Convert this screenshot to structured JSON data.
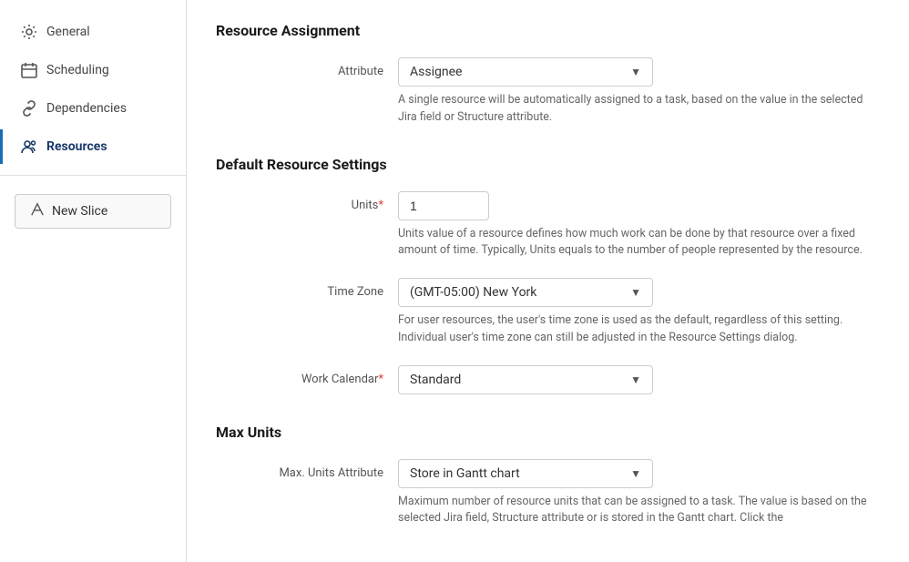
{
  "sidebar": {
    "items": [
      {
        "id": "general",
        "label": "General",
        "icon": "settings-icon",
        "active": false
      },
      {
        "id": "scheduling",
        "label": "Scheduling",
        "icon": "calendar-icon",
        "active": false
      },
      {
        "id": "dependencies",
        "label": "Dependencies",
        "icon": "link-icon",
        "active": false
      },
      {
        "id": "resources",
        "label": "Resources",
        "icon": "people-icon",
        "active": true
      }
    ],
    "new_slice_label": "New Slice"
  },
  "main": {
    "sections": [
      {
        "id": "resource-assignment",
        "title": "Resource Assignment",
        "fields": [
          {
            "id": "attribute",
            "label": "Attribute",
            "required": false,
            "type": "dropdown",
            "value": "Assignee",
            "helper": "A single resource will be automatically assigned to a task, based on the value in the selected Jira field or Structure attribute."
          }
        ]
      },
      {
        "id": "default-resource-settings",
        "title": "Default Resource Settings",
        "fields": [
          {
            "id": "units",
            "label": "Units",
            "required": true,
            "type": "text",
            "value": "1",
            "helper": "Units value of a resource defines how much work can be done by that resource over a fixed amount of time. Typically, Units equals to the number of people represented by the resource."
          },
          {
            "id": "time-zone",
            "label": "Time Zone",
            "required": false,
            "type": "dropdown",
            "value": "(GMT-05:00) New York",
            "helper": "For user resources, the user's time zone is used as the default, regardless of this setting. Individual user's time zone can still be adjusted in the Resource Settings dialog."
          },
          {
            "id": "work-calendar",
            "label": "Work Calendar",
            "required": true,
            "type": "dropdown",
            "value": "Standard",
            "helper": ""
          }
        ]
      },
      {
        "id": "max-units",
        "title": "Max Units",
        "fields": [
          {
            "id": "max-units-attribute",
            "label": "Max. Units Attribute",
            "required": false,
            "type": "dropdown",
            "value": "Store in Gantt chart",
            "helper": "Maximum number of resource units that can be assigned to a task. The value is based on the selected Jira field, Structure attribute or is stored in the Gantt chart. Click the"
          }
        ]
      }
    ]
  },
  "colors": {
    "active_border": "#1a6db5",
    "active_text": "#1a3a6b"
  }
}
